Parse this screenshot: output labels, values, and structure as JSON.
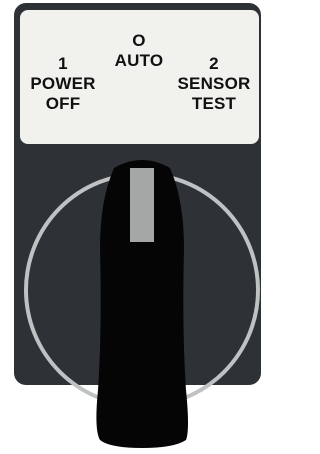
{
  "switch": {
    "positions": [
      {
        "number": "1",
        "line1": "POWER",
        "line2": "OFF"
      },
      {
        "number": "O",
        "line1": "AUTO"
      },
      {
        "number": "2",
        "line1": "SENSOR",
        "line2": "TEST"
      }
    ]
  },
  "colors": {
    "housing": "#2e3236",
    "label_panel": "#f1f2ee",
    "label_text": "#111111",
    "dial_ring": "#bfc2c2",
    "handle": "#050505",
    "indicator": "#a4a7a6"
  }
}
